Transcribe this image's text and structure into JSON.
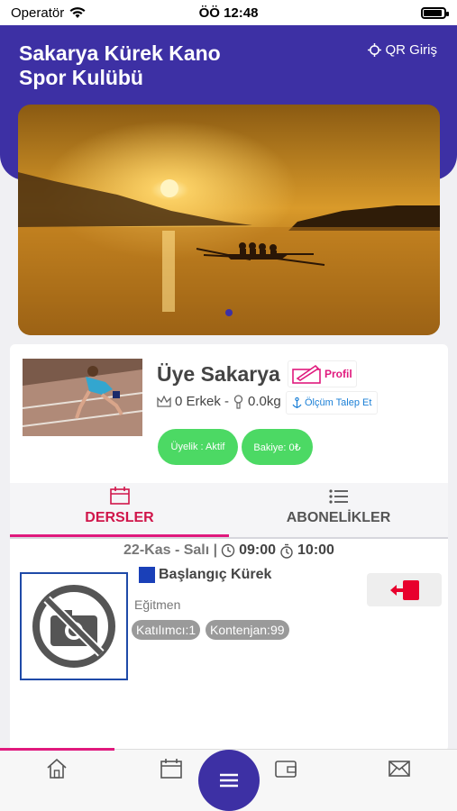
{
  "status": {
    "carrier": "Operatör",
    "time": "ÖÖ 12:48",
    "battery_level": 0.9
  },
  "header": {
    "title": "Sakarya Kürek Kano Spor Kulübü",
    "qr_label": "QR Giriş"
  },
  "banner": {
    "icon": "rowing-sunset-photo",
    "active_slide": 1
  },
  "member": {
    "name": "Üye Sakarya",
    "profile_label": "Profil",
    "stats": "0 Erkek -",
    "weight": "0.0kg",
    "measure_label": "Ölçüm Talep Et",
    "membership_label": "Üyelik : Aktif",
    "balance_label": "Bakiye: 0₺"
  },
  "tabs": [
    {
      "label": "DERSLER",
      "icon": "calendar-icon",
      "active": true
    },
    {
      "label": "ABONELİKLER",
      "icon": "list-icon",
      "active": false
    }
  ],
  "lesson": {
    "date": "22-Kas - Salı |",
    "start": "09:00",
    "end": "10:00",
    "title": "Başlangıç Kürek",
    "trainer": "Eğitmen",
    "participants": "Katılımcı:1",
    "quota": "Kontenjan:99"
  },
  "colors": {
    "primary": "#3d30a4",
    "accent": "#e0197d",
    "success": "#4cd964",
    "danger": "#e8002d"
  }
}
